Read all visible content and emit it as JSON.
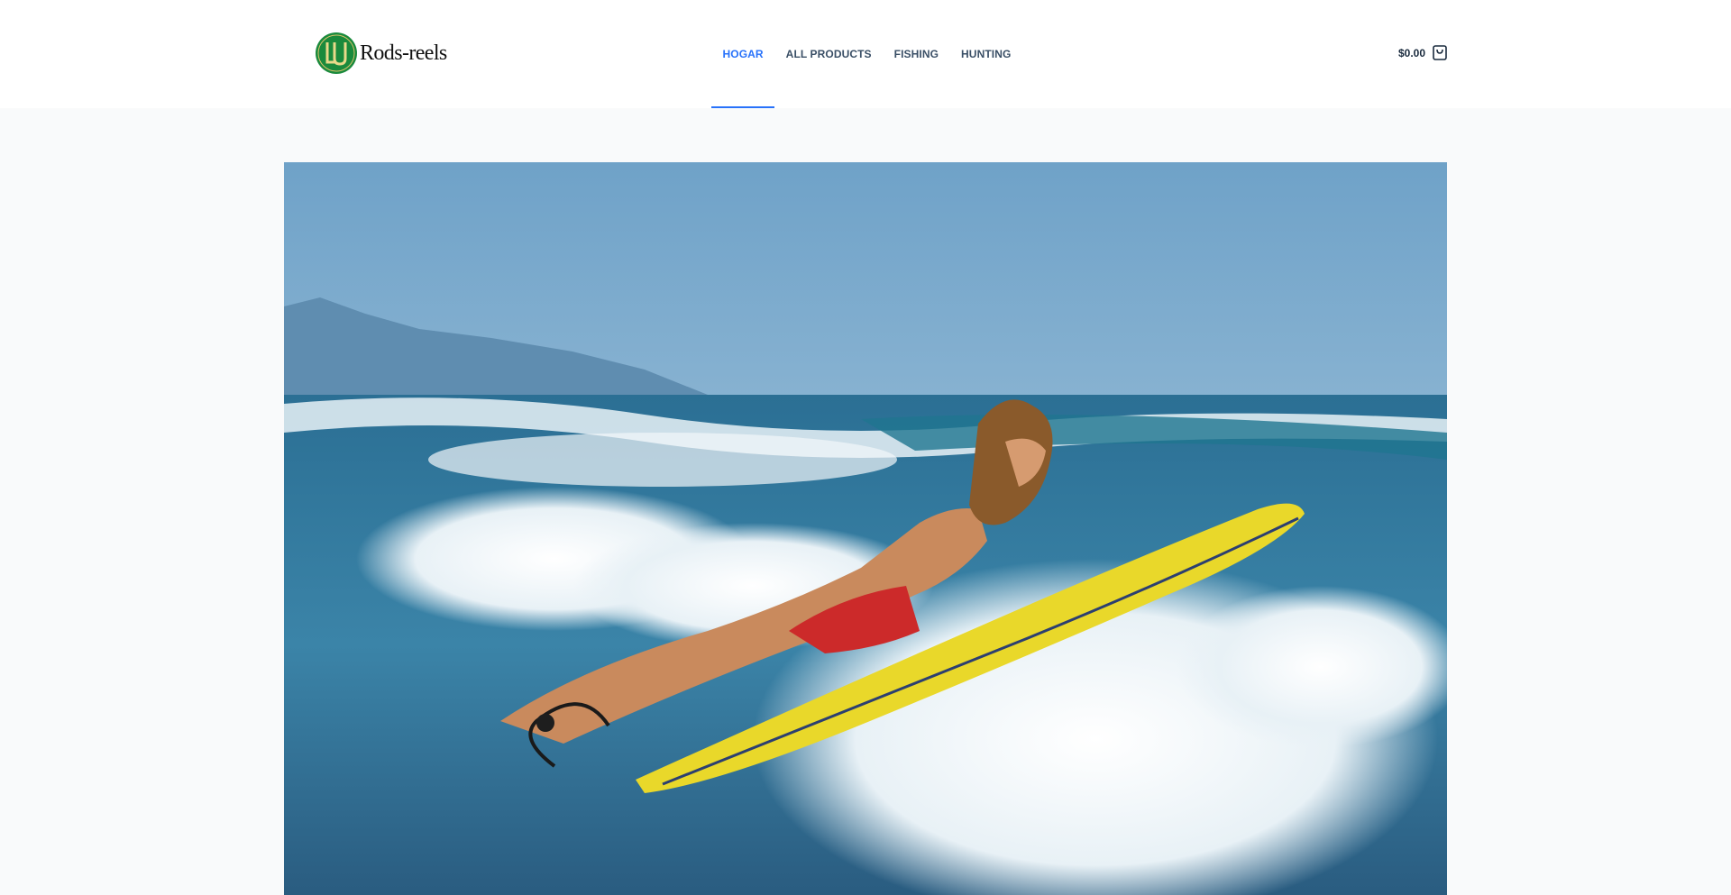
{
  "brand": {
    "name": "Rods-reels",
    "logo_icon": "monogram-lu-circle",
    "logo_color": "#1a8a3c"
  },
  "nav": {
    "items": [
      {
        "label": "HOGAR",
        "active": true
      },
      {
        "label": "ALL PRODUCTS",
        "active": false
      },
      {
        "label": "FISHING",
        "active": false
      },
      {
        "label": "HUNTING",
        "active": false
      }
    ]
  },
  "cart": {
    "total": "$0.00",
    "icon": "shopping-bag-icon"
  },
  "hero": {
    "image": "surfer-woman-paddling-into-waves"
  },
  "colors": {
    "accent": "#2872fa",
    "nav_text": "#3a4f66",
    "page_background": "#f9fafb",
    "header_background": "#ffffff"
  }
}
